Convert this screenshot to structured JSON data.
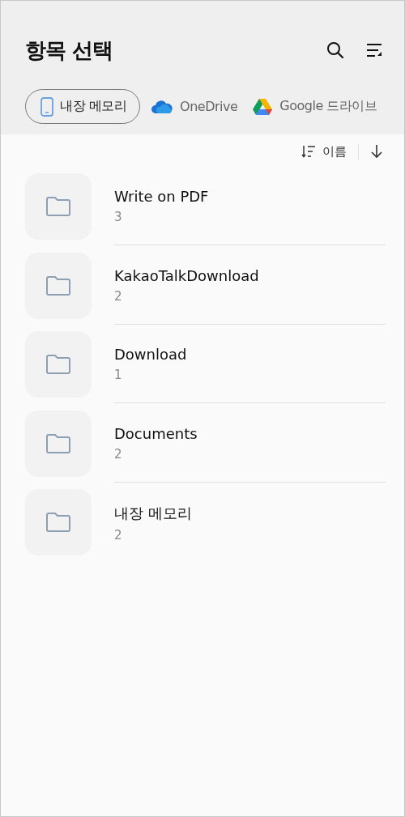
{
  "header": {
    "title": "항목 선택"
  },
  "storage_tabs": [
    {
      "kind": "phone",
      "label": "내장 메모리",
      "selected": true
    },
    {
      "kind": "onedrive",
      "label": "OneDrive",
      "selected": false
    },
    {
      "kind": "gdrive",
      "label": "Google 드라이브",
      "selected": false
    }
  ],
  "sort_bar": {
    "label": "이름"
  },
  "folders": [
    {
      "name": "Write on PDF",
      "count": "3"
    },
    {
      "name": "KakaoTalkDownload",
      "count": "2"
    },
    {
      "name": "Download",
      "count": "1"
    },
    {
      "name": "Documents",
      "count": "2"
    },
    {
      "name": "내장 메모리",
      "count": "2"
    }
  ]
}
